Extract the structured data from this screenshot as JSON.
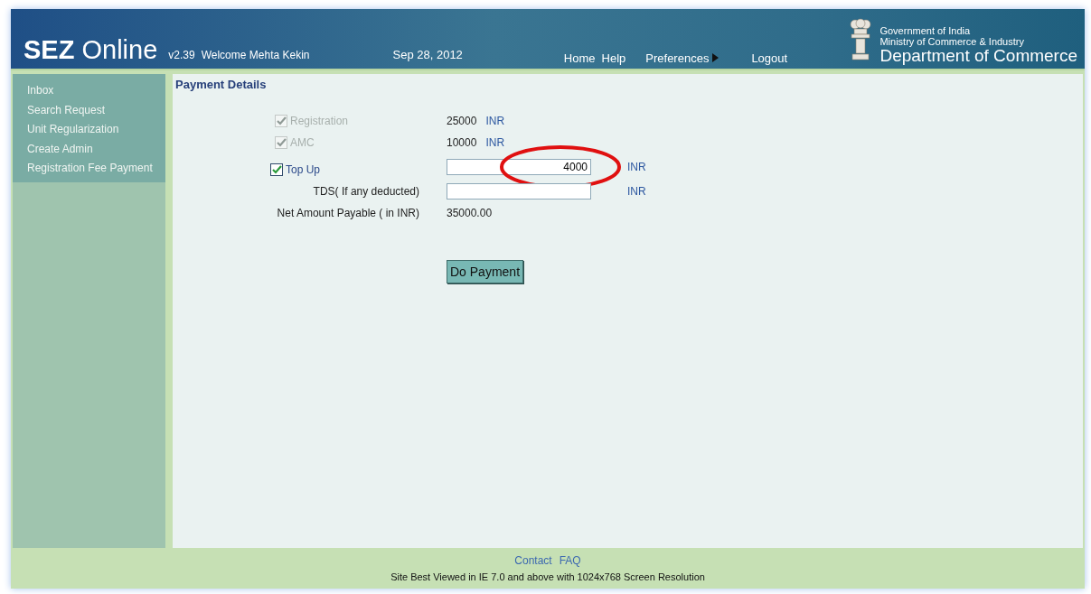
{
  "header": {
    "logo_bold": "SEZ",
    "logo_rest": "Online",
    "version": "v2.39",
    "welcome": "Welcome Mehta Kekin",
    "date": "Sep 28, 2012",
    "nav": [
      {
        "label": "Home",
        "has_arrow": false
      },
      {
        "label": "Help",
        "has_arrow": false
      },
      {
        "label": "Preferences",
        "has_arrow": true
      },
      {
        "label": "Logout",
        "has_arrow": false
      }
    ],
    "org_lines": [
      "Government of India",
      "Ministry of Commerce & Industry"
    ],
    "department": "Department of Commerce"
  },
  "sidebar": {
    "items": [
      {
        "label": "Inbox"
      },
      {
        "label": "Search Request"
      },
      {
        "label": "Unit Regularization"
      },
      {
        "label": "Create Admin"
      },
      {
        "label": "Registration Fee Payment"
      }
    ]
  },
  "page_title": "Payment Details",
  "fees": [
    {
      "kind": "fixed",
      "label": "Registration",
      "checked": true,
      "disabled": true,
      "amount": "25000",
      "currency": "INR"
    },
    {
      "kind": "fixed",
      "label": "AMC",
      "checked": true,
      "disabled": true,
      "amount": "10000",
      "currency": "INR"
    },
    {
      "kind": "input",
      "label": "Top Up",
      "checked": true,
      "disabled": false,
      "value": "4000",
      "currency": "INR",
      "highlighted": true
    }
  ],
  "tds": {
    "label": "TDS( If any deducted)",
    "currency": "INR"
  },
  "net": {
    "label": "Net Amount Payable ( in INR)",
    "value": "35000.00"
  },
  "pay_button": "Do Payment",
  "footer": {
    "links": [
      "Contact",
      "FAQ"
    ],
    "note": "Site Best Viewed in IE 7.0 and above with 1024x768 Screen Resolution"
  }
}
